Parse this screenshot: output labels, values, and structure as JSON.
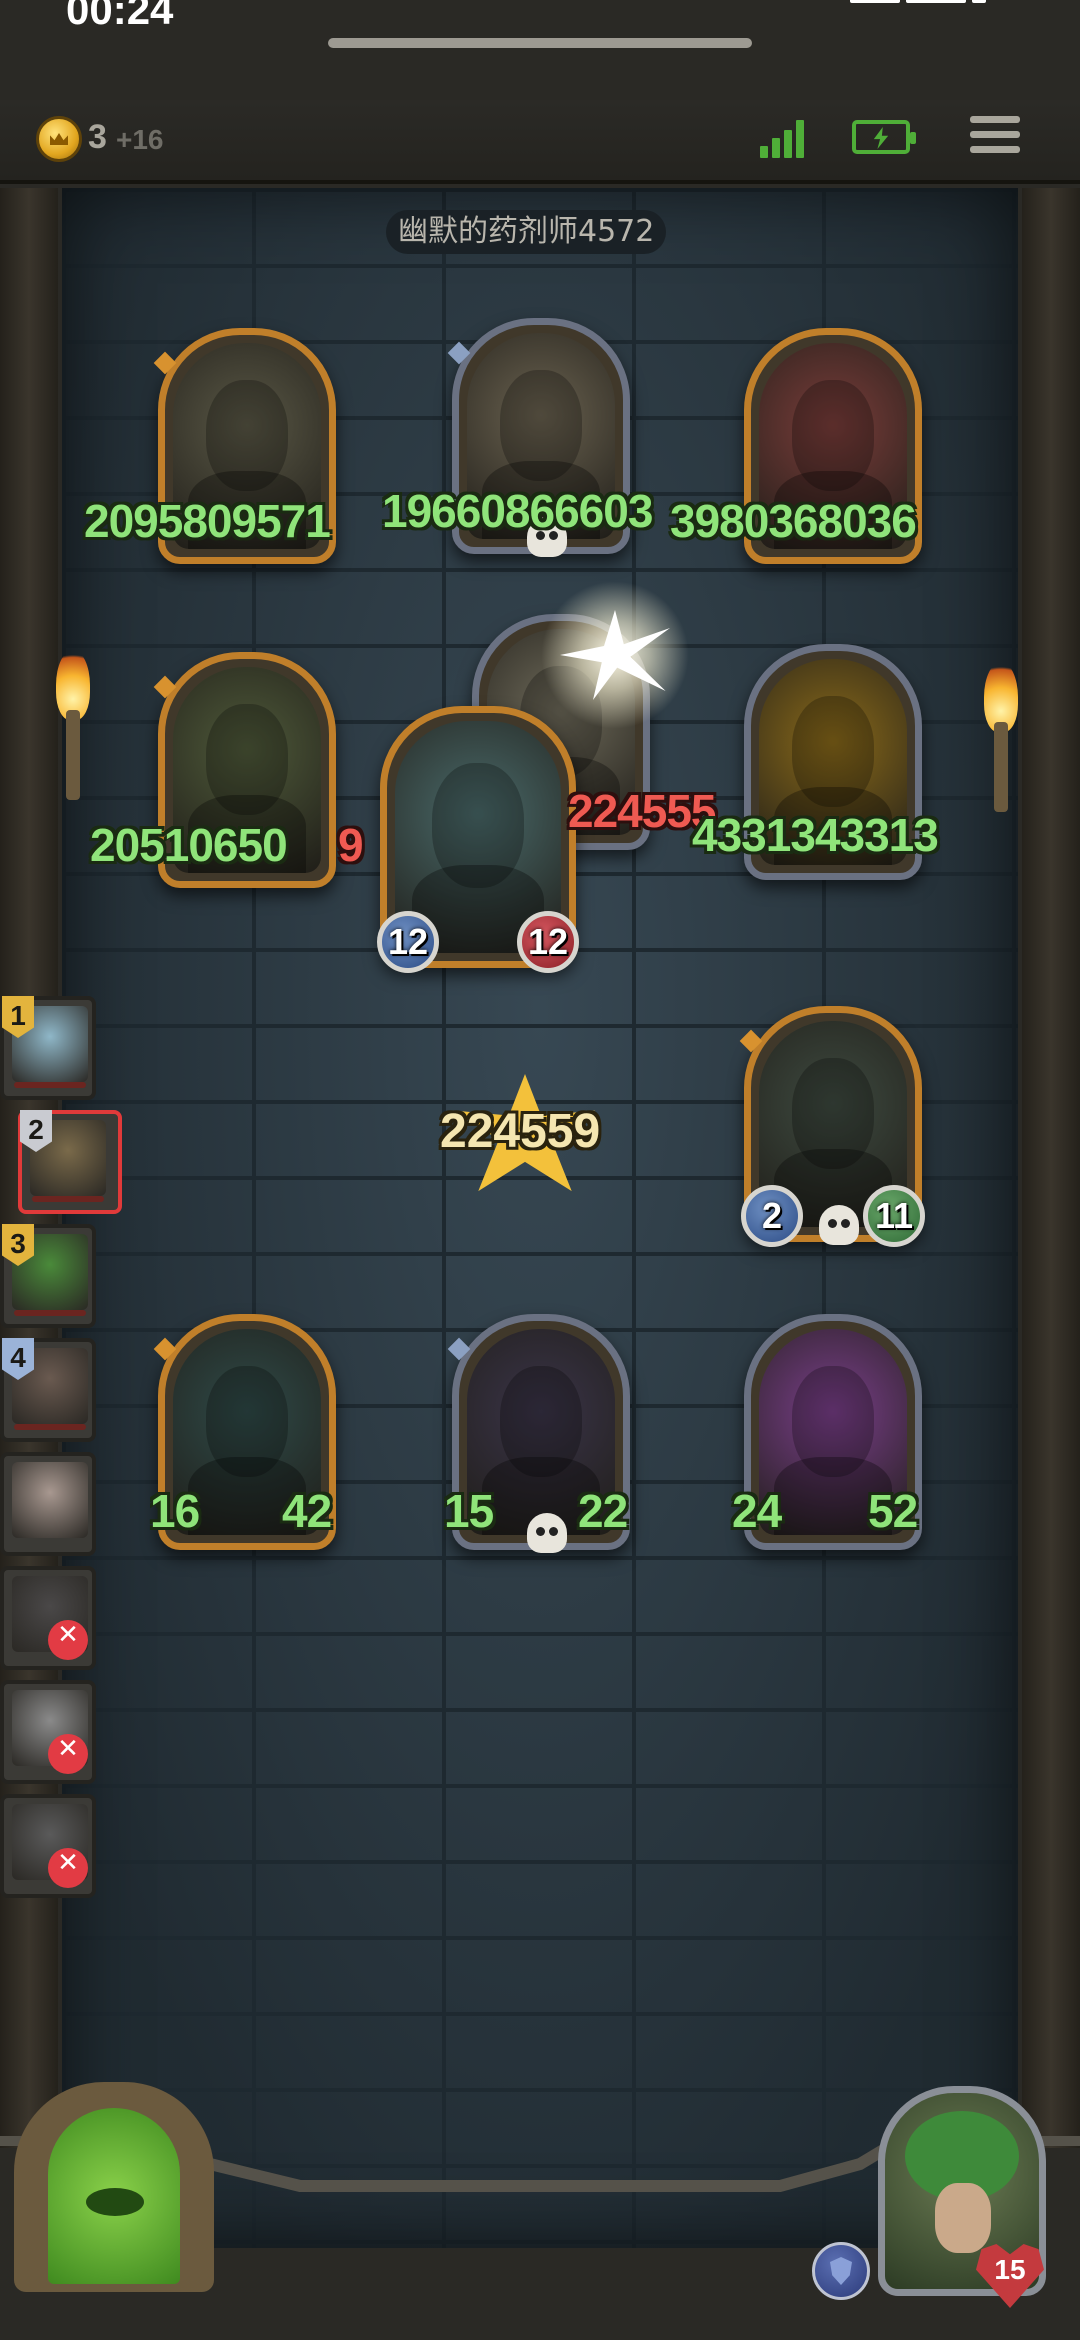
{
  "status_bar": {
    "time": "00:24"
  },
  "hud": {
    "coins": "3",
    "coins_bonus": "+16"
  },
  "board": {
    "boss_label": "幽默的药剂师4572",
    "damage_popup": "224559",
    "enemies": [
      {
        "id": "enemy-hooded-skull-mage",
        "frame": "gold",
        "art_color": "#5a5846",
        "stat_text": "2095809571",
        "stat_color": "green"
      },
      {
        "id": "enemy-bone-dragon",
        "frame": "silver",
        "art_color": "#6a6250",
        "stat_text": "19660866603",
        "stat_color": "green",
        "skull": true
      },
      {
        "id": "enemy-clown",
        "frame": "gold",
        "art_color": "#7a3d3a",
        "stat_text": "3980368036",
        "stat_color": "green"
      },
      {
        "id": "enemy-purple-dragon",
        "frame": "gold",
        "art_color": "#4f5a3a",
        "stat_text": "20510650",
        "stat_text_red": "9",
        "stat_color": "green"
      },
      {
        "id": "enemy-shadow-beast-hit",
        "frame": "silver",
        "art_color": "#6e6a5a",
        "stat_text": "224555",
        "stat_color": "red"
      },
      {
        "id": "enemy-golden-guardian",
        "frame": "silver",
        "art_color": "#8a6a1a",
        "stat_text": "4331343313",
        "stat_color": "green"
      }
    ],
    "attacker": {
      "id": "blue-horned-imp",
      "frame": "gold",
      "art_color": "#4a6a6a",
      "attack": "12",
      "health": "12"
    },
    "allies": [
      {
        "id": "ally-tentacle-chest",
        "frame": "gold",
        "art_color": "#3e4a40",
        "attack": "2",
        "health": "11",
        "skull": true
      },
      {
        "id": "ally-hooded-reaper",
        "frame": "gold",
        "art_color": "#2f4a48",
        "attack": "16",
        "health": "42"
      },
      {
        "id": "ally-dark-lord",
        "frame": "silver",
        "art_color": "#3a3448",
        "attack": "15",
        "health": "22",
        "skull": true
      },
      {
        "id": "ally-old-wizard",
        "frame": "silver-purple",
        "art_color": "#7a3f8a",
        "attack": "24",
        "health": "52"
      }
    ]
  },
  "turn_order": [
    {
      "number": "1",
      "badge": "gold",
      "color": "#8fb7c8",
      "dead": false,
      "active": false
    },
    {
      "number": "2",
      "badge": "silver",
      "color": "#7a6a4a",
      "dead": false,
      "active": true
    },
    {
      "number": "3",
      "badge": "gold",
      "color": "#4a8a3a",
      "dead": false,
      "active": false
    },
    {
      "number": "4",
      "badge": "blue",
      "color": "#6a5a50",
      "dead": false,
      "active": false
    },
    {
      "number": "",
      "badge": "",
      "color": "#a89890",
      "dead": false,
      "active": false
    },
    {
      "number": "",
      "badge": "",
      "color": "#4a4848",
      "dead": true,
      "active": false
    },
    {
      "number": "",
      "badge": "",
      "color": "#8a8a8a",
      "dead": true,
      "active": false
    },
    {
      "number": "",
      "badge": "",
      "color": "#5a5a5a",
      "dead": true,
      "active": false
    }
  ],
  "hero": {
    "health": "15"
  },
  "colors": {
    "wall": "#2b3942",
    "gold_frame": "#c07f2a",
    "silver_frame": "#6a7182",
    "green_text": "#8fe47a",
    "red_text": "#ef5a52"
  },
  "icons": [
    "coin-icon",
    "signal-icon",
    "battery-icon",
    "menu-icon",
    "skull-icon",
    "shield-icon",
    "heart-icon",
    "dead-marker-icon"
  ]
}
